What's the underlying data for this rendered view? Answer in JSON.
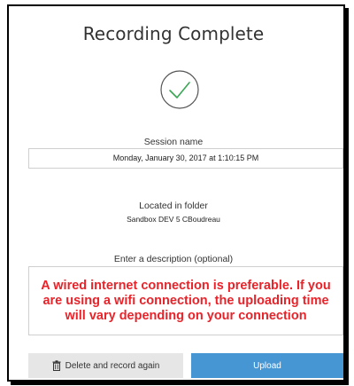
{
  "dialog": {
    "title": "Recording Complete",
    "success_icon": "checkmark-circle-icon",
    "success_color": "#3aa655"
  },
  "session": {
    "label": "Session name",
    "value": "Monday, January 30, 2017 at 1:10:15 PM"
  },
  "folder": {
    "label": "Located in folder",
    "name": "Sandbox DEV 5 CBoudreau"
  },
  "description": {
    "label": "Enter a description (optional)",
    "value": "A wired internet connection is preferable. If you are using a wifi connection, the uploading time will vary depending on your connection",
    "text_color": "#e8232a"
  },
  "actions": {
    "delete_label": "Delete and record again",
    "delete_icon": "trash-icon",
    "upload_label": "Upload",
    "upload_color": "#4796d4"
  }
}
